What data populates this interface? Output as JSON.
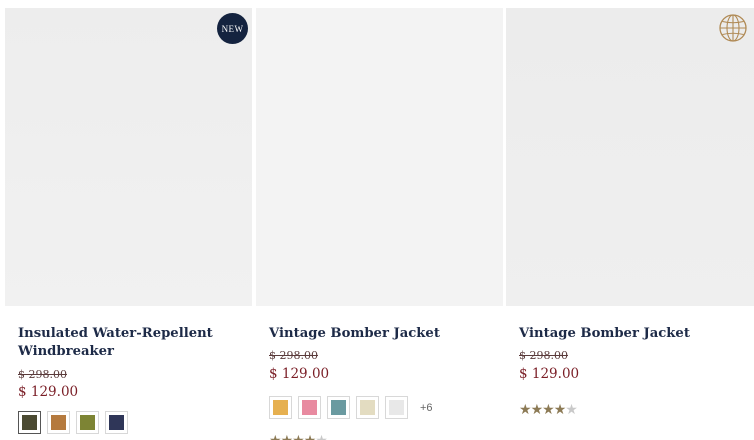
{
  "products": [
    {
      "name": "Insulated Water-Repellent Windbreaker",
      "old_price": "$ 298.00",
      "price": "$ 129.00",
      "badge": "NEW",
      "swatch_colors": [
        "#4b4a32",
        "#b57a3e",
        "#7d8434",
        "#2f3658"
      ],
      "image_colors": {
        "jacket": "#4a5233",
        "shirt": "#a9c6e6",
        "pants": "#cfcbc3",
        "skin": "#d9a98b",
        "hair": "#2b1f18"
      }
    },
    {
      "name": "Vintage Bomber Jacket",
      "old_price": "$ 298.00",
      "price": "$ 129.00",
      "swatch_colors": [
        "#e6b050",
        "#e88aa0",
        "#6a9aa0",
        "#e3dcc1",
        "#e8e8e8"
      ],
      "more_colors": "+6",
      "rating": 4,
      "image_colors": {
        "jacket": "#2a3247",
        "shirt": "#e9e9e9",
        "pants": "#7b7450",
        "skin": "#d9a98b",
        "hair": "#3b2b20"
      }
    },
    {
      "name": "Vintage Bomber Jacket",
      "old_price": "$ 298.00",
      "price": "$ 129.00",
      "rating": 4,
      "badge_icon": "globe-icon",
      "image_colors": {
        "jacket": "#6e1d26",
        "sweater": "#1f1f1f",
        "shirt": "#e6e6ea",
        "pants": "#4a4a30",
        "skin": "#dcab8e",
        "hair": "#8a6a3a"
      }
    }
  ],
  "colors": {
    "title": "#1d2a47",
    "sale_price": "#7a1e26",
    "star": "#8c7a55",
    "badge_bg": "#14233f"
  }
}
